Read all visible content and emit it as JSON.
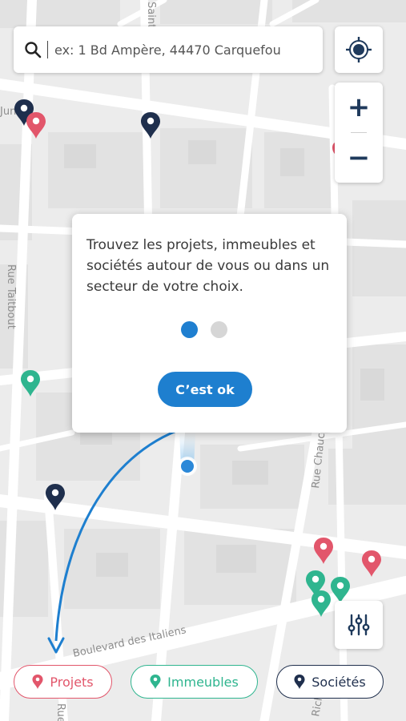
{
  "search": {
    "placeholder": "ex: 1 Bd Ampère, 44470 Carquefou"
  },
  "map": {
    "street_labels": {
      "rue_taitbout": "Rue Taitbout",
      "boulevard_italiens": "Boulevard des Italiens",
      "rue_chauchat": "Rue Chauchat",
      "rue_saint": "Saint-",
      "rue_richelieu": "Rich",
      "edge_rue": "Rue",
      "edge_jun": "Jun"
    }
  },
  "controls": {
    "zoom_in_label": "+",
    "zoom_out_label": "−"
  },
  "onboarding": {
    "message": "Trouvez les projets, immeubles et sociétés autour de vous ou dans un secteur de votre choix.",
    "ok_label": "C’est ok",
    "page": 1,
    "page_count": 2
  },
  "filters": {
    "projets": "Projets",
    "immeubles": "Immeubles",
    "societes": "Sociétés"
  },
  "colors": {
    "projets": "#e2566b",
    "immeubles": "#2fb58f",
    "societes": "#1f2f4d",
    "accent": "#1e7fcf"
  }
}
